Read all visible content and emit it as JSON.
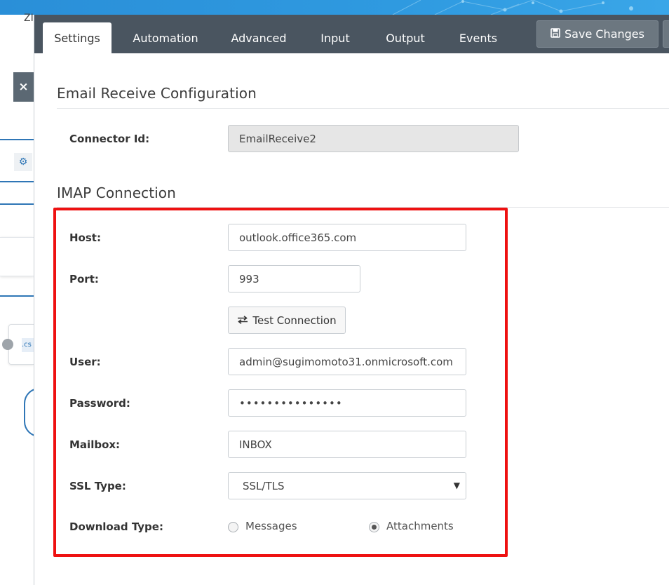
{
  "colors": {
    "tabbar": "#4a5560",
    "highlight": "#ee1111",
    "topbar": "#2f9ae0"
  },
  "background": {
    "close_glyph": "×",
    "card_text": "ZI",
    "node_text": ".cs"
  },
  "tabs": [
    {
      "label": "Settings",
      "active": true
    },
    {
      "label": "Automation",
      "active": false
    },
    {
      "label": "Advanced",
      "active": false
    },
    {
      "label": "Input",
      "active": false
    },
    {
      "label": "Output",
      "active": false
    },
    {
      "label": "Events",
      "active": false
    }
  ],
  "toolbar": {
    "save_label": "Save Changes",
    "save_icon": "floppy-disk-icon"
  },
  "email_section": {
    "title": "Email Receive Configuration",
    "connector_id_label": "Connector Id:",
    "connector_id_value": "EmailReceive2"
  },
  "imap_section": {
    "title": "IMAP Connection",
    "host_label": "Host:",
    "host_value": "outlook.office365.com",
    "port_label": "Port:",
    "port_value": "993",
    "test_button_label": "Test Connection",
    "test_button_icon": "exchange-arrows-icon",
    "user_label": "User:",
    "user_value": "admin@sugimomoto31.onmicrosoft.com",
    "password_label": "Password:",
    "password_value": "•••••••••••••••",
    "mailbox_label": "Mailbox:",
    "mailbox_value": "INBOX",
    "ssl_label": "SSL Type:",
    "ssl_value": "SSL/TLS",
    "download_label": "Download Type:",
    "download_options": [
      {
        "label": "Messages",
        "checked": false
      },
      {
        "label": "Attachments",
        "checked": true
      }
    ]
  }
}
